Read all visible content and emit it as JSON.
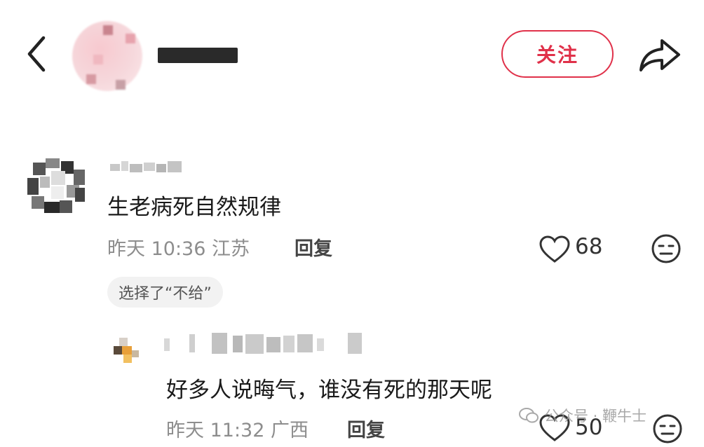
{
  "header": {
    "follow_label": "关注",
    "back_icon": "chevron-left-icon",
    "share_icon": "share-arrow-icon",
    "accent_color": "#e0314a"
  },
  "comments": [
    {
      "text": "生老病死自然规律",
      "meta": "昨天 10:36 江苏",
      "reply_label": "回复",
      "like_count": "68",
      "chip": "选择了“不给”"
    },
    {
      "text": "好多人说晦气，谁没有死的那天呢",
      "meta": "昨天 11:32 广西",
      "reply_label": "回复",
      "like_count": "50"
    }
  ],
  "watermark": {
    "text": "公众号 · 鞭牛士"
  }
}
